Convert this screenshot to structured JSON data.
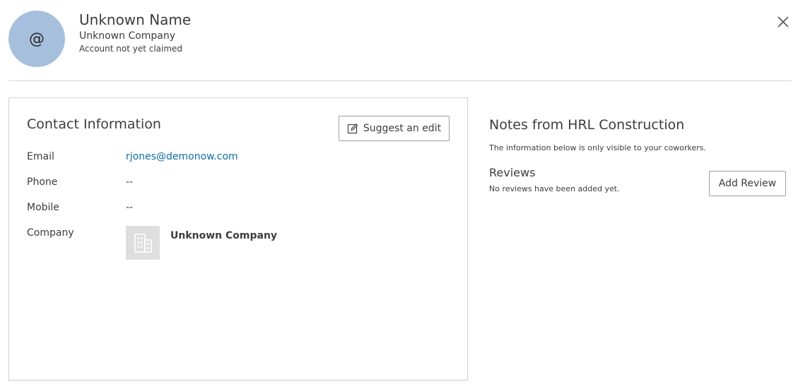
{
  "profile": {
    "avatar_glyph": "@",
    "name": "Unknown Name",
    "company": "Unknown Company",
    "claim_status": "Account not yet claimed",
    "avatar_color": "#a6bfdd"
  },
  "contact": {
    "title": "Contact Information",
    "suggest_edit_label": "Suggest an edit",
    "fields": [
      {
        "label": "Email",
        "value": "rjones@demonow.com"
      },
      {
        "label": "Phone",
        "value": "--"
      },
      {
        "label": "Mobile",
        "value": "--"
      },
      {
        "label": "Company",
        "value": "Unknown Company"
      }
    ],
    "link_color": "#0f6ea8"
  },
  "notes": {
    "title": "Notes from HRL Construction",
    "subtitle": "The information below is only visible to your coworkers.",
    "reviews_title": "Reviews",
    "reviews_empty": "No reviews have been added yet.",
    "add_review_label": "Add Review"
  },
  "icons": {
    "close": "close-icon",
    "edit": "pencil-edit-icon",
    "company": "building-icon"
  }
}
